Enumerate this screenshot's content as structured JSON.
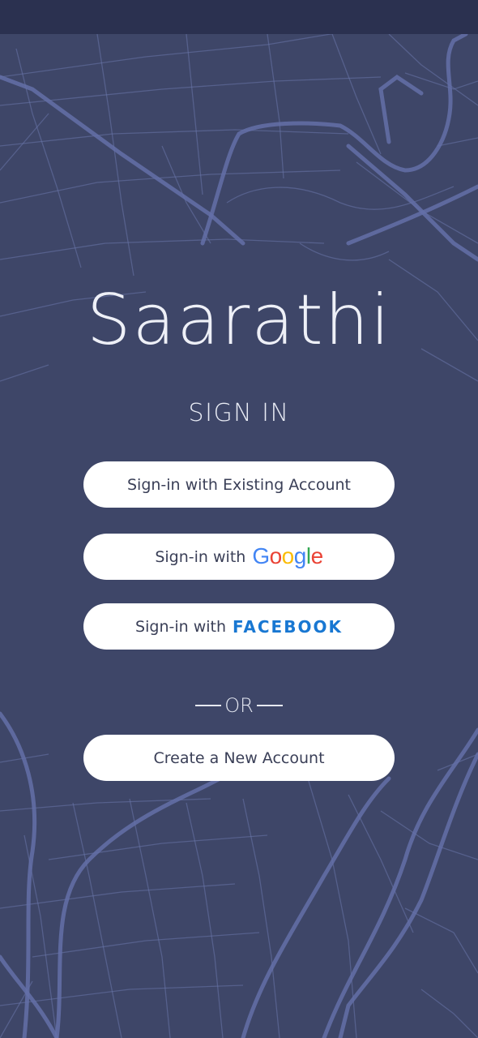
{
  "app": {
    "title": "Saarathi"
  },
  "sign_in": {
    "heading": "SIGN IN",
    "existing_account_label": "Sign-in with Existing Account",
    "google_lead": "Sign-in with",
    "google_logo": "Google",
    "facebook_lead": "Sign-in with",
    "facebook_logo": "FACEBOOK"
  },
  "divider": {
    "label": "OR"
  },
  "create_account": {
    "label": "Create a New Account"
  },
  "colors": {
    "background": "#3e4668",
    "status_bar": "#2b3150",
    "map_lines": "#6672a8",
    "button_bg": "#ffffff",
    "button_text": "#3a3f57",
    "facebook": "#1877d2"
  }
}
